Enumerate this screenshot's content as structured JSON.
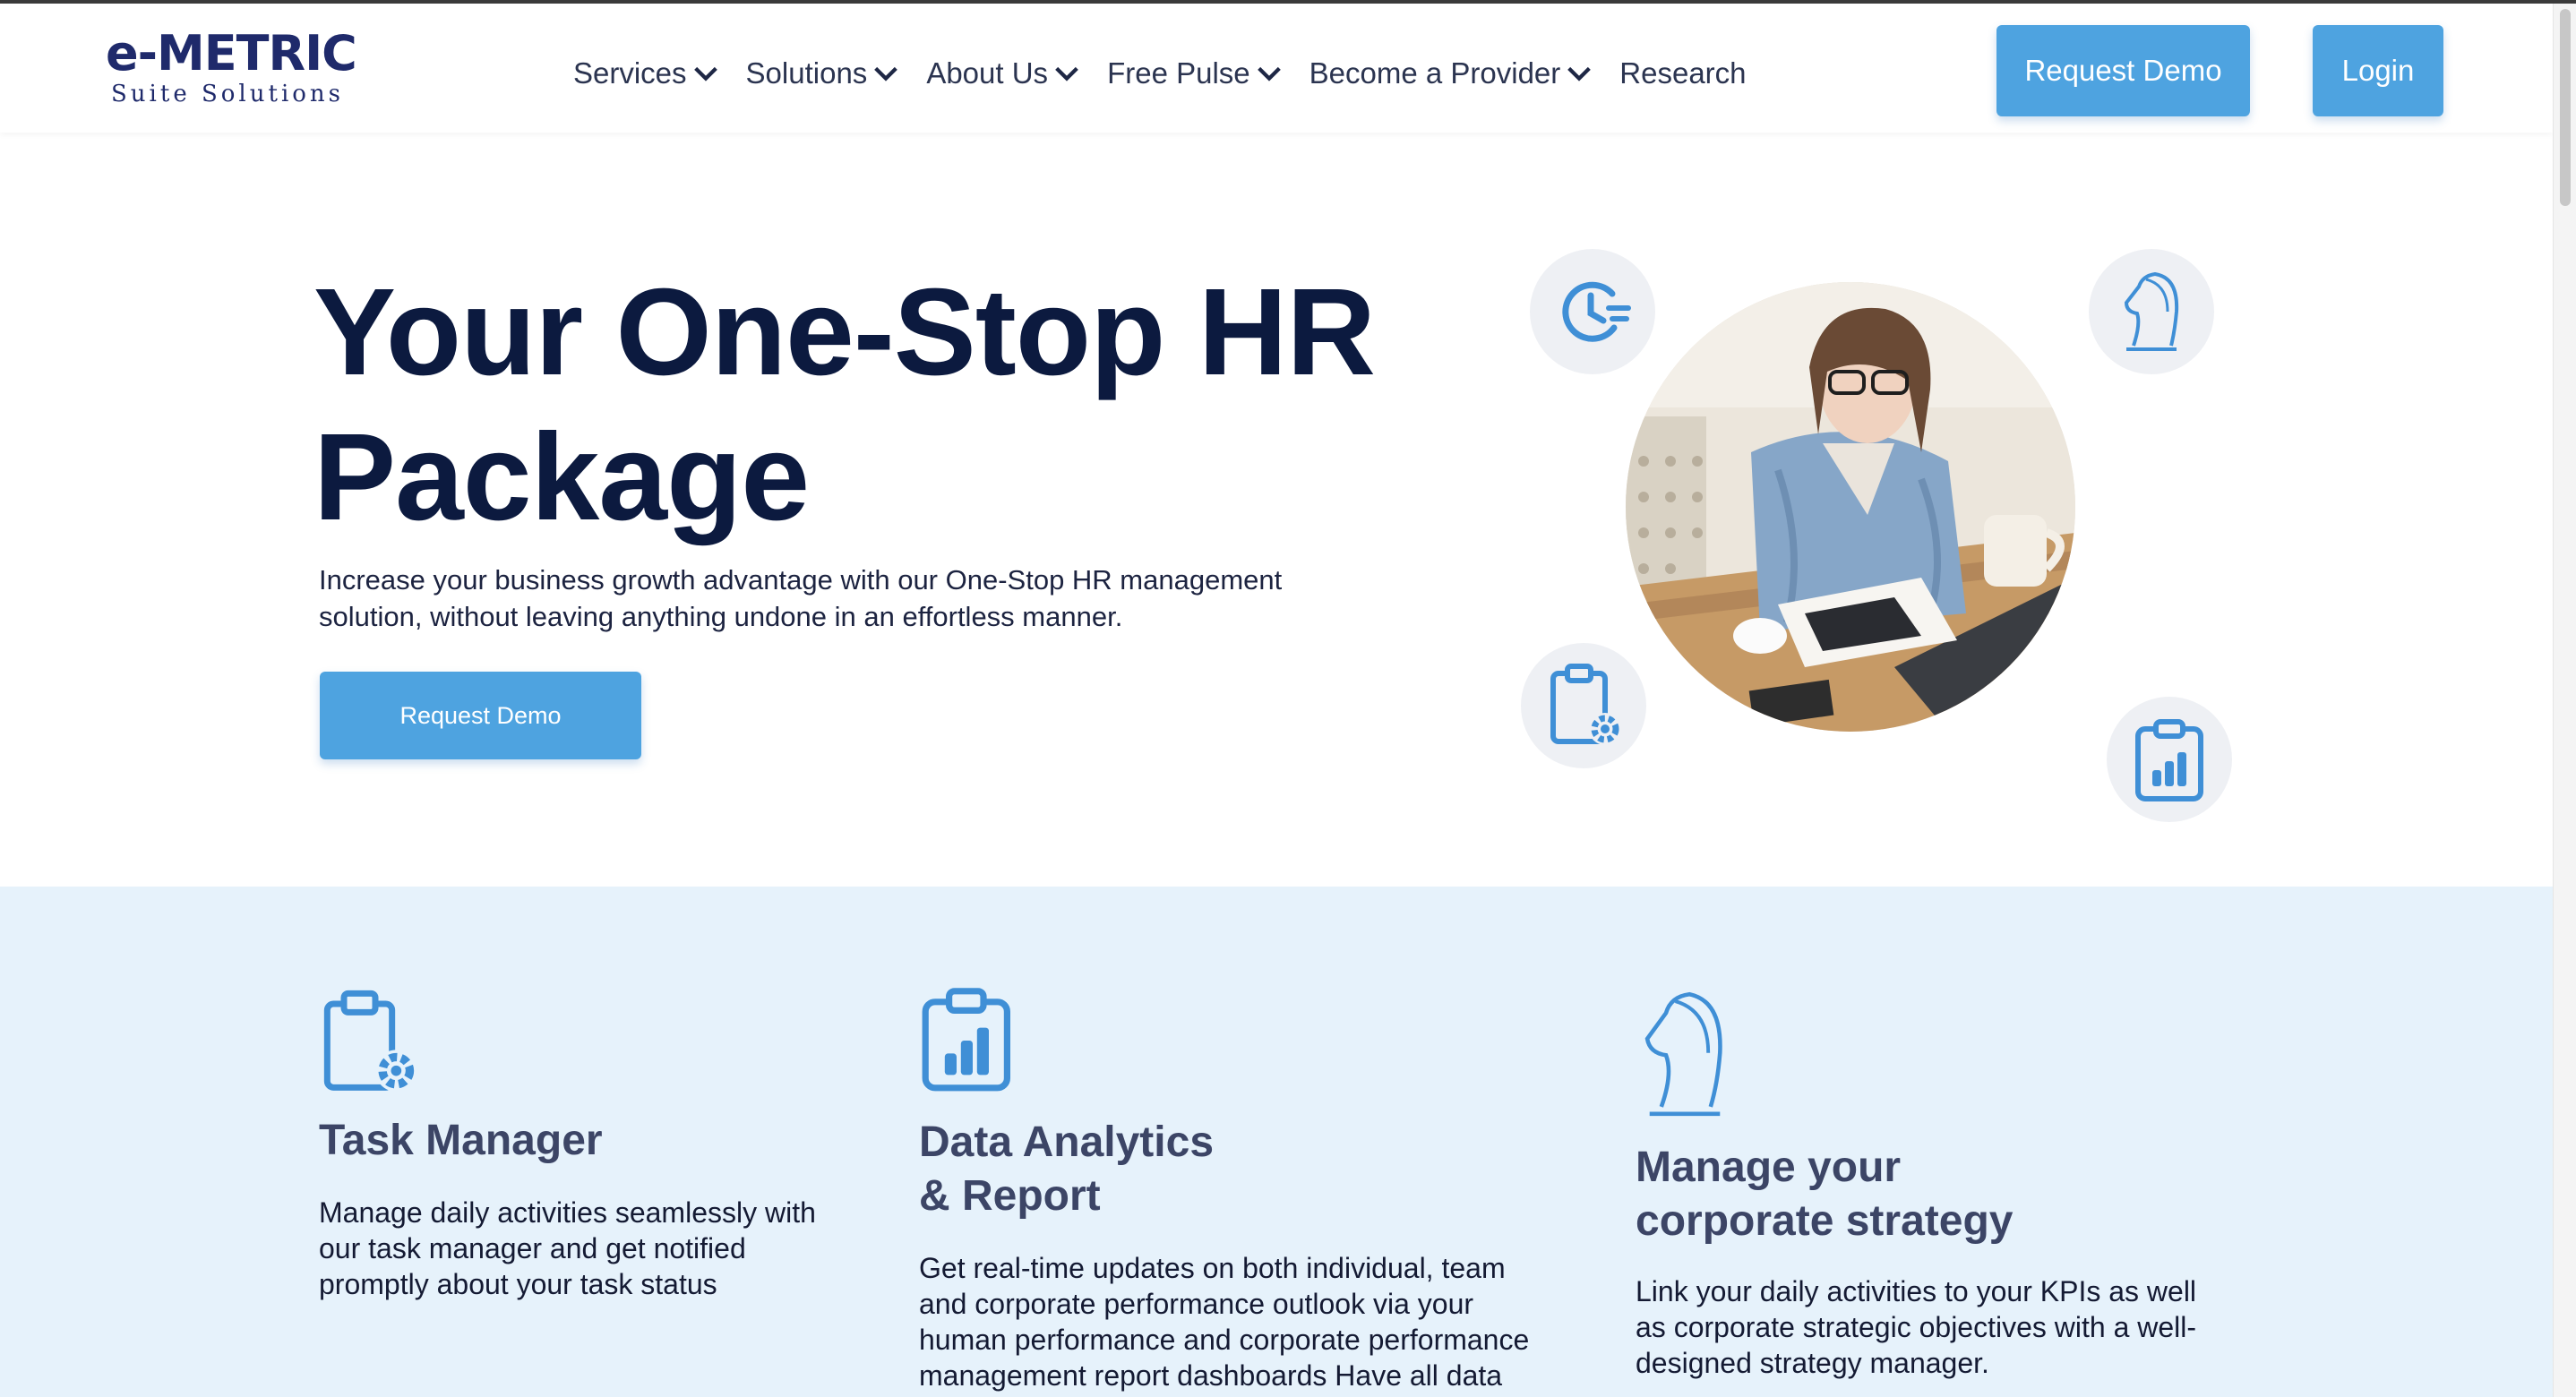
{
  "brand": {
    "logo_main": "e-METRIC",
    "logo_sub": "Suite Solutions",
    "accent": "#4ea3e0",
    "navy": "#0c1a3f"
  },
  "nav": {
    "items": [
      {
        "label": "Services",
        "dropdown": true
      },
      {
        "label": "Solutions",
        "dropdown": true
      },
      {
        "label": "About Us",
        "dropdown": true
      },
      {
        "label": "Free Pulse",
        "dropdown": true
      },
      {
        "label": "Become a Provider",
        "dropdown": true
      },
      {
        "label": "Research",
        "dropdown": false
      }
    ],
    "request_demo": "Request Demo",
    "login": "Login"
  },
  "hero": {
    "title_line1": "Your One-Stop HR",
    "title_line2": "Package",
    "subtitle_line1": "Increase your business growth advantage with our One-Stop HR management",
    "subtitle_line2": "solution, without leaving anything undone in an effortless manner.",
    "cta": "Request Demo",
    "bubble_icons": [
      "clock-icon",
      "chess-knight-icon",
      "clipboard-gear-icon",
      "clipboard-chart-icon"
    ]
  },
  "features": [
    {
      "icon": "clipboard-gear-icon",
      "title_lines": [
        "Task Manager"
      ],
      "desc_lines": [
        "Manage daily activities seamlessly with",
        "our task manager and get notified",
        "promptly about your task status"
      ]
    },
    {
      "icon": "clipboard-chart-icon",
      "title_lines": [
        "Data Analytics",
        "& Report"
      ],
      "desc_lines": [
        "Get real-time updates on both individual, team",
        "and corporate performance outlook via your",
        "human performance and corporate performance",
        "management report dashboards Have all data"
      ]
    },
    {
      "icon": "chess-knight-icon",
      "title_lines": [
        "Manage your",
        "corporate strategy"
      ],
      "desc_lines": [
        "Link your daily activities to your KPIs as well",
        "as corporate strategic objectives with a well-",
        "designed strategy manager."
      ]
    }
  ]
}
